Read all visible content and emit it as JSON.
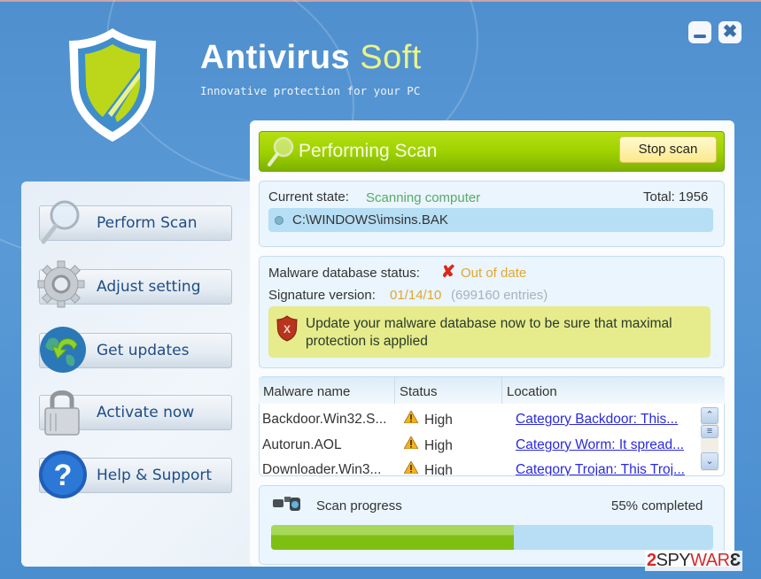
{
  "app": {
    "title_main": "Antivirus",
    "title_accent": "Soft",
    "tagline": "Innovative protection for your PC",
    "window_buttons": {
      "minimize": "minimize-icon",
      "close": "✖"
    }
  },
  "sidebar": {
    "items": [
      {
        "label": "Perform Scan",
        "icon": "magnifier-icon"
      },
      {
        "label": "Adjust setting",
        "icon": "gear-icon"
      },
      {
        "label": "Get updates",
        "icon": "globe-update-icon"
      },
      {
        "label": "Activate now",
        "icon": "padlock-icon"
      },
      {
        "label": "Help & Support",
        "icon": "help-icon"
      }
    ]
  },
  "scan_header": {
    "title": "Performing Scan",
    "stop_label": "Stop scan"
  },
  "current_state": {
    "label": "Current state:",
    "value": "Scanning computer",
    "total_label": "Total: 1956",
    "current_file": "C:\\WINDOWS\\imsins.BAK"
  },
  "database": {
    "status_label": "Malware database status:",
    "status_icon": "✘",
    "status_value": "Out of date",
    "signature_label": "Signature version:",
    "signature_date": "01/14/10",
    "signature_entries": "(699160 entries)",
    "warning_line1": "Update your malware database now to be sure that maximal",
    "warning_line2": "protection is applied"
  },
  "threats_table": {
    "columns": [
      "Malware name",
      "Status",
      "Location"
    ],
    "rows": [
      {
        "name": "Backdoor.Win32.S...",
        "status": "High",
        "location": "Category Backdoor: This..."
      },
      {
        "name": "Autorun.AOL",
        "status": "High",
        "location": "Category Worm: It spread..."
      },
      {
        "name": "Downloader.Win3...",
        "status": "High",
        "location": "Category Trojan: This Troj..."
      }
    ],
    "scroll_up": "⌃",
    "scroll_thumb": "≡",
    "scroll_down": "⌄"
  },
  "progress": {
    "label": "Scan progress",
    "percent": 55,
    "percent_text": "55% completed"
  },
  "watermark": {
    "part1": "2",
    "part2": "SPY",
    "part3": "WAR",
    "part4": "Ɛ"
  },
  "colors": {
    "accent_green": "#9dd000",
    "title_accent": "#e9f48a",
    "status_orange": "#e1a72e",
    "state_green": "#5aa86a",
    "link_blue": "#2a2ae0",
    "danger_red": "#d82a1a"
  }
}
